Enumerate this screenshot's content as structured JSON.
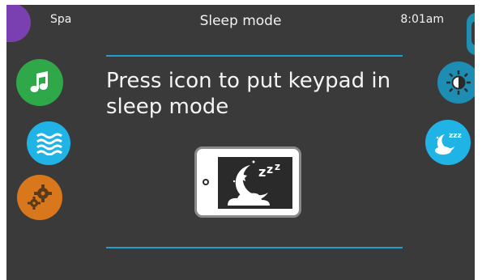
{
  "header": {
    "app_label": "Spa",
    "title": "Sleep mode",
    "time": "8:01am"
  },
  "main": {
    "message": "Press icon to put keypad in sleep mode"
  },
  "icons": {
    "music": "music-note-icon",
    "waves": "water-waves-icon",
    "gears": "gears-icon",
    "brightness": "brightness-icon",
    "sleep": "sleep-moon-icon"
  },
  "colors": {
    "accent": "#1ea0cc",
    "green": "#2fa84a",
    "cyan": "#20b4e6",
    "orange": "#d8771b",
    "purple": "#7a3fb0",
    "teal": "#1d8db3"
  }
}
